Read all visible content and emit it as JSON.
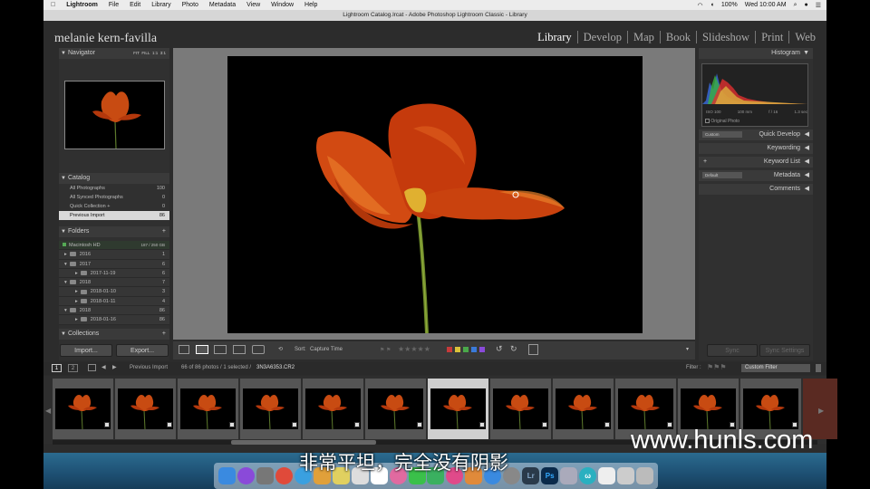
{
  "menubar": {
    "items": [
      "Lightroom",
      "File",
      "Edit",
      "Library",
      "Photo",
      "Metadata",
      "View",
      "Window",
      "Help"
    ],
    "battery": "100%",
    "clock": "Wed 10:00 AM"
  },
  "window": {
    "title": "Lightroom Catalog.lrcat - Adobe Photoshop Lightroom Classic - Library"
  },
  "identity_plate": "melanie kern-favilla",
  "modules": [
    "Library",
    "Develop",
    "Map",
    "Book",
    "Slideshow",
    "Print",
    "Web"
  ],
  "navigator": {
    "title": "Navigator",
    "zoom_options": [
      "FIT",
      "FILL",
      "1:1",
      "3:1"
    ]
  },
  "catalog": {
    "title": "Catalog",
    "items": [
      {
        "label": "All Photographs",
        "count": "100"
      },
      {
        "label": "All Synced Photographs",
        "count": "0"
      },
      {
        "label": "Quick Collection +",
        "count": "0"
      },
      {
        "label": "Previous Import",
        "count": "86"
      }
    ]
  },
  "folders": {
    "title": "Folders",
    "volume": {
      "label": "Macintosh HD",
      "info": "187 / 250 GB"
    },
    "items": [
      {
        "label": "2016",
        "count": "1"
      },
      {
        "label": "2017",
        "count": "6"
      },
      {
        "label": "2017-11-19",
        "count": "6"
      },
      {
        "label": "2018",
        "count": "7"
      },
      {
        "label": "2018-01-10",
        "count": "3"
      },
      {
        "label": "2018-01-11",
        "count": "4"
      },
      {
        "label": "2018",
        "count": "86"
      },
      {
        "label": "2018-01-16",
        "count": "86"
      }
    ]
  },
  "collections": {
    "title": "Collections"
  },
  "left_buttons": {
    "import": "Import...",
    "export": "Export..."
  },
  "toolbar": {
    "sort_label": "Sort:",
    "sort_value": "Capture Time",
    "flag_colors": [
      "#c63a3a",
      "#d9c23a",
      "#4aa84a",
      "#3a7ad9",
      "#8a4ad9"
    ]
  },
  "histogram": {
    "title": "Histogram",
    "iso": "ISO 100",
    "focal": "100 mm",
    "aperture": "f / 16",
    "shutter": "1.3 sec",
    "original_photo": "Original Photo"
  },
  "right_panels": [
    {
      "label": "Quick Develop",
      "preset": "Custom"
    },
    {
      "label": "Keywording"
    },
    {
      "label": "Keyword List"
    },
    {
      "label": "Metadata",
      "preset": "Default"
    },
    {
      "label": "Comments"
    }
  ],
  "right_buttons": {
    "sync": "Sync",
    "sync_settings": "Sync Settings"
  },
  "filmstrip_bar": {
    "views": [
      "1",
      "2"
    ],
    "source": "Previous Import",
    "status": "66 of 86 photos / 1 selected /",
    "filename": "3N3A6353.CR2",
    "filter_label": "Filter :",
    "filter_value": "Custom Filter"
  },
  "subtitle": "非常平坦，完全没有阴影",
  "watermark": "www.hunls.com",
  "dock_icons": [
    "finder-icon",
    "siri-icon",
    "launchpad-icon",
    "chrome-icon",
    "safari-icon",
    "photos-app-icon",
    "notes-icon",
    "files-icon",
    "calendar-icon",
    "photos-icon",
    "messages-icon",
    "facetime-icon",
    "music-icon",
    "books-icon",
    "appstore-icon",
    "system-preferences-icon",
    "lightroom-icon",
    "photoshop-icon",
    "rocket-icon",
    "wunderlist-icon",
    "document-icon",
    "preview-icon",
    "trash-icon"
  ]
}
